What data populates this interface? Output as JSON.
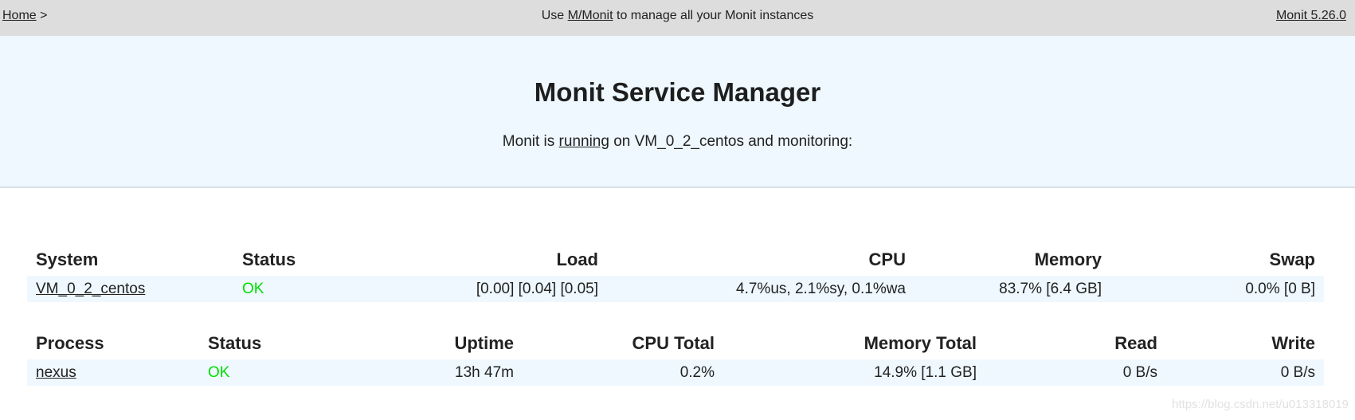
{
  "topbar": {
    "home_label": "Home",
    "breadcrumb_sep": ">",
    "center_prefix": "Use",
    "mmonit_link": "M/Monit",
    "center_suffix": "to manage all your Monit instances",
    "version_link": "Monit 5.26.0"
  },
  "banner": {
    "title": "Monit Service Manager",
    "subtitle_prefix": "Monit is",
    "running_link": "running",
    "subtitle_suffix": "on VM_0_2_centos and monitoring:"
  },
  "system_table": {
    "headers": [
      "System",
      "Status",
      "Load",
      "CPU",
      "Memory",
      "Swap"
    ],
    "row": {
      "system": "VM_0_2_centos",
      "status": "OK",
      "load": "[0.00] [0.04] [0.05]",
      "cpu": "4.7%us, 2.1%sy, 0.1%wa",
      "memory": "83.7% [6.4 GB]",
      "swap": "0.0% [0 B]"
    }
  },
  "process_table": {
    "headers": [
      "Process",
      "Status",
      "Uptime",
      "CPU Total",
      "Memory Total",
      "Read",
      "Write"
    ],
    "row": {
      "process": "nexus",
      "status": "OK",
      "uptime": "13h 47m",
      "cpu_total": "0.2%",
      "memory_total": "14.9% [1.1 GB]",
      "read": "0 B/s",
      "write": "0 B/s"
    }
  },
  "watermark": "https://blog.csdn.net/u013318019",
  "colors": {
    "topbar_bg": "#dddddd",
    "banner_bg": "#eef8fe",
    "status_ok": "#00dd00"
  }
}
